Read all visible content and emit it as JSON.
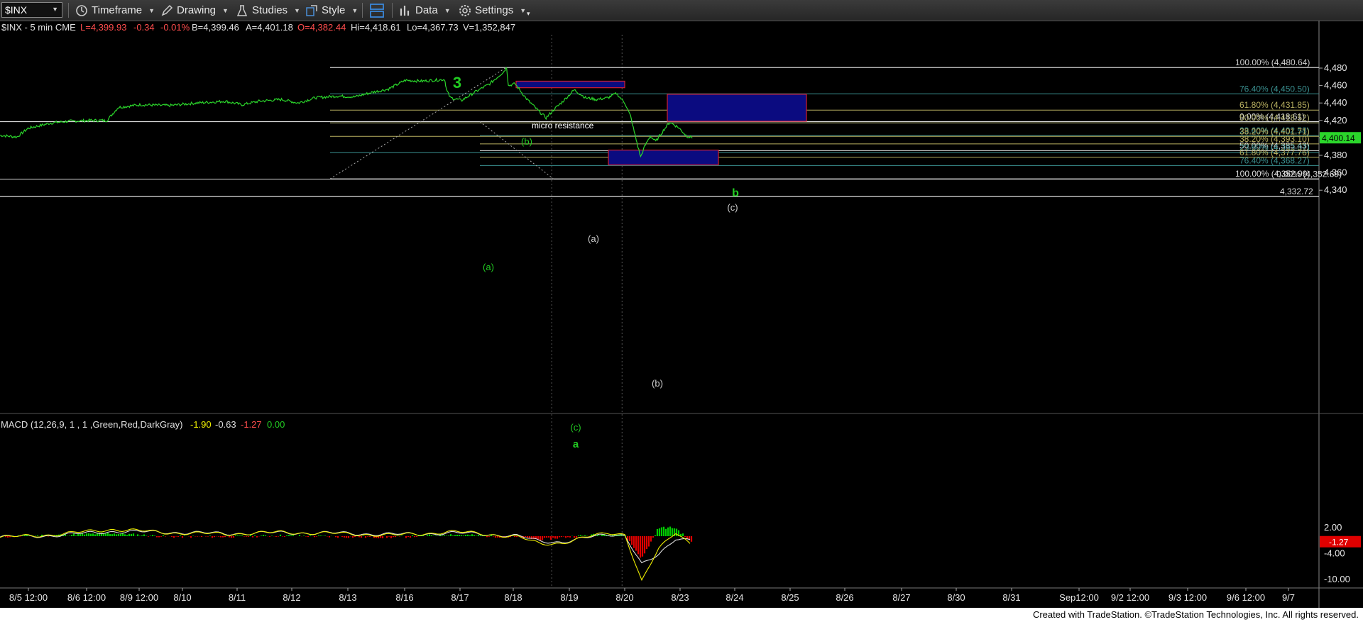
{
  "toolbar": {
    "symbol": "$INX",
    "timeframe": "Timeframe",
    "drawing": "Drawing",
    "studies": "Studies",
    "style": "Style",
    "data": "Data",
    "settings": "Settings"
  },
  "header": {
    "symbol_info": "$INX - 5 min  CME",
    "last": "L=4,399.93",
    "change": "-0.34",
    "pct": "-0.01%",
    "bid": "B=4,399.46",
    "ask": "A=4,401.18",
    "open": "O=4,382.44",
    "high": "Hi=4,418.61",
    "low": "Lo=4,367.73",
    "volume": "V=1,352,847"
  },
  "macd_header": {
    "label": "MACD (12,26,9, 1 , 1 ,Green,Red,DarkGray)",
    "v1": "-1.90",
    "v2": "-0.63",
    "v3": "-1.27",
    "v4": "0.00"
  },
  "footer": "Created with TradeStation. ©TradeStation Technologies, Inc. All rights reserved.",
  "colors": {
    "price": "#2bd62b",
    "macd": "#f0f000",
    "signal": "#dddddd",
    "hist_pos": "#00cc00",
    "hist_neg": "#e00000",
    "box_fill": "#0b0b80",
    "box_border": "#d21f2f",
    "label_green": "#22cc22"
  },
  "chart_data": {
    "type": "line",
    "title": "",
    "ylim": [
      4318,
      4494
    ],
    "yticks": [
      4340,
      4360,
      4380,
      4400,
      4420,
      4440,
      4460,
      4480
    ],
    "ytick_labels": [
      "4,340",
      "4,360",
      "4,380",
      "4,400",
      "4,420",
      "4,440",
      "4,460",
      "4,480"
    ],
    "x_labels": [
      "8/5 12:00",
      "8/6 12:00",
      "8/9 12:00",
      "8/10",
      "8/11",
      "8/12",
      "8/13",
      "8/16",
      "8/17",
      "8/18",
      "8/19",
      "8/20",
      "8/23",
      "8/24",
      "8/25",
      "8/26",
      "8/27",
      "8/30",
      "8/31",
      "Sep12:00",
      "9/2 12:00",
      "9/3 12:00",
      "9/6 12:00",
      "9/7"
    ],
    "last_price_label": "4,400.14",
    "price_series": {
      "name": "$INX",
      "points": [
        [
          0,
          4403
        ],
        [
          0.3,
          4401
        ],
        [
          0.5,
          4411
        ],
        [
          0.9,
          4417
        ],
        [
          1.2,
          4419
        ],
        [
          1.6,
          4420
        ],
        [
          1.9,
          4420
        ],
        [
          2.1,
          4435
        ],
        [
          2.5,
          4438
        ],
        [
          3.0,
          4437
        ],
        [
          3.5,
          4440
        ],
        [
          4.0,
          4442
        ],
        [
          4.3,
          4438
        ],
        [
          4.6,
          4442
        ],
        [
          5.0,
          4444
        ],
        [
          5.3,
          4440
        ],
        [
          5.6,
          4446
        ],
        [
          6.0,
          4448
        ],
        [
          6.3,
          4447
        ],
        [
          6.6,
          4452
        ],
        [
          6.9,
          4456
        ],
        [
          7.2,
          4466
        ],
        [
          7.5,
          4465
        ],
        [
          7.9,
          4467
        ],
        [
          7.93,
          4455
        ],
        [
          8.0,
          4446
        ],
        [
          8.2,
          4443
        ],
        [
          8.45,
          4453
        ],
        [
          8.7,
          4462
        ],
        [
          8.95,
          4476
        ],
        [
          9.0,
          4481
        ],
        [
          9.03,
          4460
        ],
        [
          9.15,
          4462
        ],
        [
          9.35,
          4445
        ],
        [
          9.55,
          4432
        ],
        [
          9.7,
          4423
        ],
        [
          9.85,
          4433
        ],
        [
          10.0,
          4442
        ],
        [
          10.2,
          4455
        ],
        [
          10.4,
          4446
        ],
        [
          10.6,
          4444
        ],
        [
          10.8,
          4446
        ],
        [
          10.95,
          4451
        ],
        [
          11.1,
          4440
        ],
        [
          11.2,
          4425
        ],
        [
          11.3,
          4398
        ],
        [
          11.38,
          4378
        ],
        [
          11.45,
          4390
        ],
        [
          11.55,
          4402
        ],
        [
          11.65,
          4396
        ],
        [
          11.8,
          4410
        ],
        [
          11.9,
          4418
        ],
        [
          12.05,
          4412
        ],
        [
          12.2,
          4402
        ],
        [
          12.3,
          4400
        ]
      ]
    },
    "fib_levels": [
      {
        "label": "100.00% (4,480.64)",
        "y": 4480.64,
        "color": "#cfcfcf"
      },
      {
        "label": "76.40% (4,450.50)",
        "y": 4450.5,
        "color": "#3a8f8f"
      },
      {
        "label": "61.80% (4,431.85)",
        "y": 4431.85,
        "color": "#b8b060"
      },
      {
        "label": "0.00% (4,418.61)",
        "y": 4418.61,
        "color": "#dddddd"
      },
      {
        "label": "50.00% (4,418.52)",
        "y": 4417.2,
        "color": "#b0b070"
      },
      {
        "label": "23.60% (4,402.58)",
        "y": 4402.58,
        "color": "#3a8f8f"
      },
      {
        "label": "38.20% (4,401.71)",
        "y": 4401.71,
        "color": "#b8b060"
      },
      {
        "label": "38.20% (4,393.10)",
        "y": 4393.1,
        "color": "#b8b060"
      },
      {
        "label": "50.00% (4,385.43)",
        "y": 4385.43,
        "color": "#dddddd"
      },
      {
        "label": "23.60% (4,383.07)",
        "y": 4383.07,
        "color": "#3a8f8f"
      },
      {
        "label": "61.80% (4,377.76)",
        "y": 4377.76,
        "color": "#b8b060"
      },
      {
        "label": "76.40% (4,368.27)",
        "y": 4368.27,
        "color": "#3a8f8f"
      },
      {
        "label": "100.00% (4,352.99)",
        "y": 4352.99,
        "color": "#dddddd"
      },
      {
        "label": "0.00% (4,352.69)",
        "y": 4352.69,
        "color": "#dddddd"
      },
      {
        "label": "4,332.72",
        "y": 4332.72,
        "color": "#dddddd"
      }
    ],
    "annotations": [
      {
        "text": "3",
        "color": "#22cc22"
      },
      {
        "text": "micro resistance",
        "color": "#ffffff"
      },
      {
        "text": "(b)",
        "color": "#22cc22"
      },
      {
        "text": "b",
        "color": "#22cc22"
      },
      {
        "text": "(c)",
        "color": "#cfcfcf"
      },
      {
        "text": "(a)",
        "color": "#cfcfcf"
      },
      {
        "text": "(a)",
        "color": "#22cc22"
      },
      {
        "text": "(b)",
        "color": "#cfcfcf"
      },
      {
        "text": "(c)",
        "color": "#22cc22"
      },
      {
        "text": "a",
        "color": "#22cc22"
      }
    ],
    "target_boxes": [
      {
        "name": "micro resistance",
        "y_range": [
          4457.5,
          4465
        ]
      },
      {
        "name": "b / (c) target",
        "y_range": [
          4419,
          4450
        ]
      },
      {
        "name": "(b) target",
        "y_range": [
          4369,
          4386
        ]
      }
    ],
    "macd": {
      "yticks": [
        2.0,
        -4.0,
        -10.0
      ],
      "ytick_labels": [
        "2.00",
        "-4.00",
        "-10.00"
      ],
      "current_label": "-1.27",
      "current_value": -1.27,
      "macd_points": [
        [
          0,
          -0.3
        ],
        [
          1,
          0.4
        ],
        [
          2,
          1.6
        ],
        [
          3,
          0.8
        ],
        [
          4,
          0.5
        ],
        [
          5,
          0.9
        ],
        [
          6,
          0.6
        ],
        [
          7,
          0.2
        ],
        [
          8,
          1.0
        ],
        [
          8.5,
          0.7
        ],
        [
          9.2,
          -0.2
        ],
        [
          9.6,
          -1.8
        ],
        [
          10,
          -1.5
        ],
        [
          10.8,
          0.8
        ],
        [
          11.1,
          0.5
        ],
        [
          11.4,
          -10.5
        ],
        [
          11.7,
          -3.0
        ],
        [
          12.0,
          1.0
        ],
        [
          12.3,
          -1.9
        ]
      ],
      "signal_points": [
        [
          0,
          -0.2
        ],
        [
          1,
          0.2
        ],
        [
          2,
          1.1
        ],
        [
          3,
          0.9
        ],
        [
          4,
          0.6
        ],
        [
          5,
          0.8
        ],
        [
          6,
          0.7
        ],
        [
          7,
          0.4
        ],
        [
          8,
          0.7
        ],
        [
          8.5,
          0.6
        ],
        [
          9.2,
          0.0
        ],
        [
          9.6,
          -1.2
        ],
        [
          10,
          -1.3
        ],
        [
          10.8,
          0.4
        ],
        [
          11.1,
          0.3
        ],
        [
          11.4,
          -6.5
        ],
        [
          11.7,
          -4.5
        ],
        [
          12.0,
          -0.5
        ],
        [
          12.3,
          -0.6
        ]
      ]
    }
  }
}
